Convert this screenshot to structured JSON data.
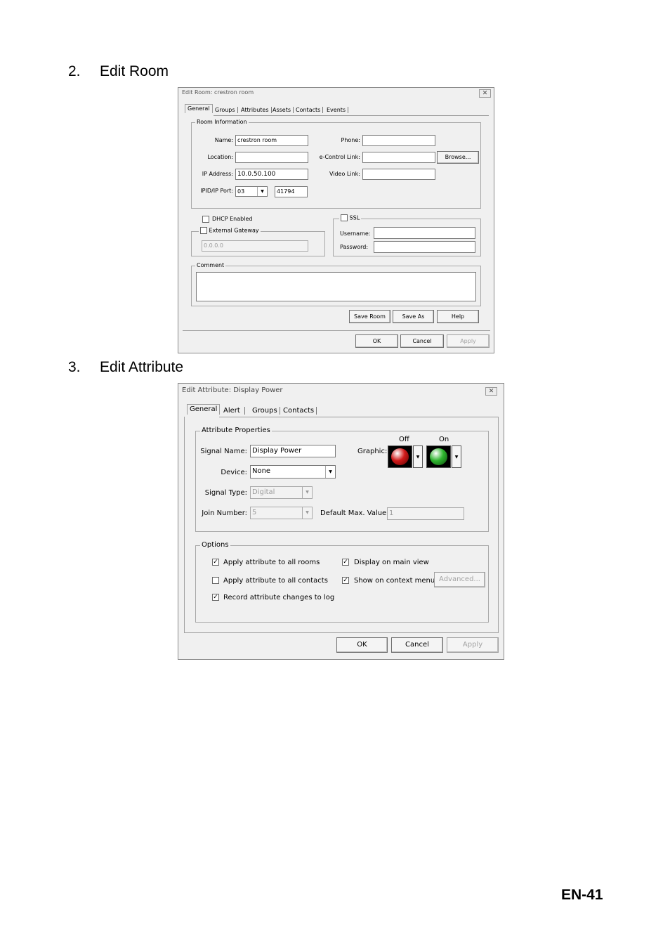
{
  "section2": {
    "number": "2.",
    "title": "Edit Room"
  },
  "section3": {
    "number": "3.",
    "title": "Edit Attribute"
  },
  "page_number": "EN-41",
  "room_dialog": {
    "title": "Edit Room: crestron room",
    "close_glyph": "✕",
    "tabs": [
      "General",
      "Groups",
      "Attributes",
      "Assets",
      "Contacts",
      "Events"
    ],
    "room_info_legend": "Room Information",
    "name_label": "Name:",
    "name_value": "crestron room",
    "location_label": "Location:",
    "location_value": "",
    "ip_label": "IP Address:",
    "ip_value": "10.0.50.100",
    "ipid_label": "IPID/IP Port:",
    "ipid_value": "03",
    "port_value": "41794",
    "phone_label": "Phone:",
    "phone_value": "",
    "econtrol_label": "e-Control Link:",
    "econtrol_value": "",
    "browse_label": "Browse...",
    "video_label": "Video Link:",
    "video_value": "",
    "dhcp_label": "DHCP Enabled",
    "gateway_label": "External Gateway",
    "gateway_value": "0.0.0.0",
    "ssl_label": "SSL",
    "username_label": "Username:",
    "password_label": "Password:",
    "comment_legend": "Comment",
    "save_room_label": "Save Room",
    "save_as_label": "Save As",
    "help_label": "Help",
    "ok_label": "OK",
    "cancel_label": "Cancel",
    "apply_label": "Apply"
  },
  "attr_dialog": {
    "title": "Edit Attribute: Display Power",
    "close_glyph": "✕",
    "tabs": [
      "General",
      "Alert",
      "Groups",
      "Contacts"
    ],
    "props_legend": "Attribute Properties",
    "signal_name_label": "Signal Name:",
    "signal_name_value": "Display Power",
    "device_label": "Device:",
    "device_value": "None",
    "signal_type_label": "Signal Type:",
    "signal_type_value": "Digital",
    "join_label": "Join Number:",
    "join_value": "5",
    "default_max_label": "Default Max. Value:",
    "default_max_value": "1",
    "graphic_label": "Graphic:",
    "off_label": "Off",
    "on_label": "On",
    "off_color": "#d11a1a",
    "on_color": "#2fb52f",
    "options_legend": "Options",
    "opt_apply_rooms": "Apply attribute to all rooms",
    "opt_apply_rooms_checked": "✓",
    "opt_apply_contacts": "Apply attribute to all contacts",
    "opt_apply_contacts_checked": "",
    "opt_record": "Record attribute changes to log",
    "opt_record_checked": "✓",
    "opt_display_main": "Display on main view",
    "opt_display_main_checked": "✓",
    "opt_context_menu": "Show on context menu",
    "opt_context_menu_checked": "✓",
    "advanced_label": "Advanced...",
    "ok_label": "OK",
    "cancel_label": "Cancel",
    "apply_label": "Apply"
  }
}
